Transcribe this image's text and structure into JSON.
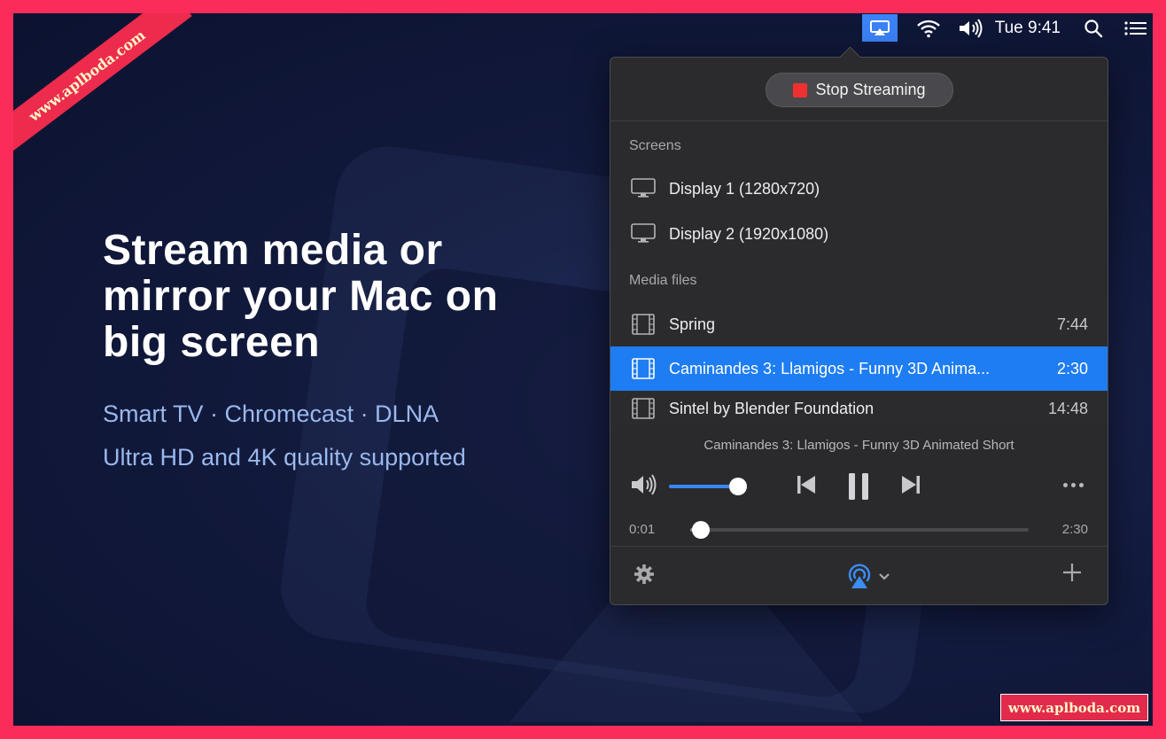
{
  "menubar": {
    "clock": "Tue 9:41",
    "icons": [
      "airplay-icon",
      "wifi-icon",
      "volume-icon",
      "search-icon",
      "menu-list-icon"
    ]
  },
  "marketing": {
    "headline": "Stream media or mirror your Mac on big screen",
    "sub_line_1": "Smart TV · Chromecast · DLNA",
    "sub_line_2": "Ultra HD and 4K quality supported"
  },
  "popover": {
    "stop_button_label": "Stop Streaming",
    "screens_header": "Screens",
    "screens": [
      {
        "label": "Display 1 (1280x720)",
        "icon": "monitor-icon"
      },
      {
        "label": "Display 2 (1920x1080)",
        "icon": "monitor-icon"
      }
    ],
    "media_header": "Media files",
    "media": [
      {
        "title": "Spring",
        "duration": "7:44",
        "selected": false,
        "icon": "film-icon"
      },
      {
        "title": "Caminandes 3: Llamigos - Funny 3D Anima...",
        "duration": "2:30",
        "selected": true,
        "icon": "film-icon"
      },
      {
        "title": "Sintel by Blender Foundation",
        "duration": "14:48",
        "selected": false,
        "icon": "film-icon"
      }
    ],
    "player": {
      "now_playing": "Caminandes 3: Llamigos - Funny 3D Animated Short",
      "volume_level": 0.85,
      "time_elapsed": "0:01",
      "time_total": "2:30",
      "progress_fraction": 0.01,
      "state": "playing"
    },
    "footer": {
      "icons": [
        "gear-icon",
        "airplay-broadcast-icon",
        "chevron-down-icon",
        "plus-icon"
      ]
    }
  },
  "colors": {
    "accent": "#1e7df3",
    "frame": "#fc2c5a",
    "stop": "#f03030",
    "subtitle": "#9ab8ec"
  },
  "watermarks": {
    "ribbon": "www.aplboda.com",
    "badge": "www.aplboda.com"
  }
}
